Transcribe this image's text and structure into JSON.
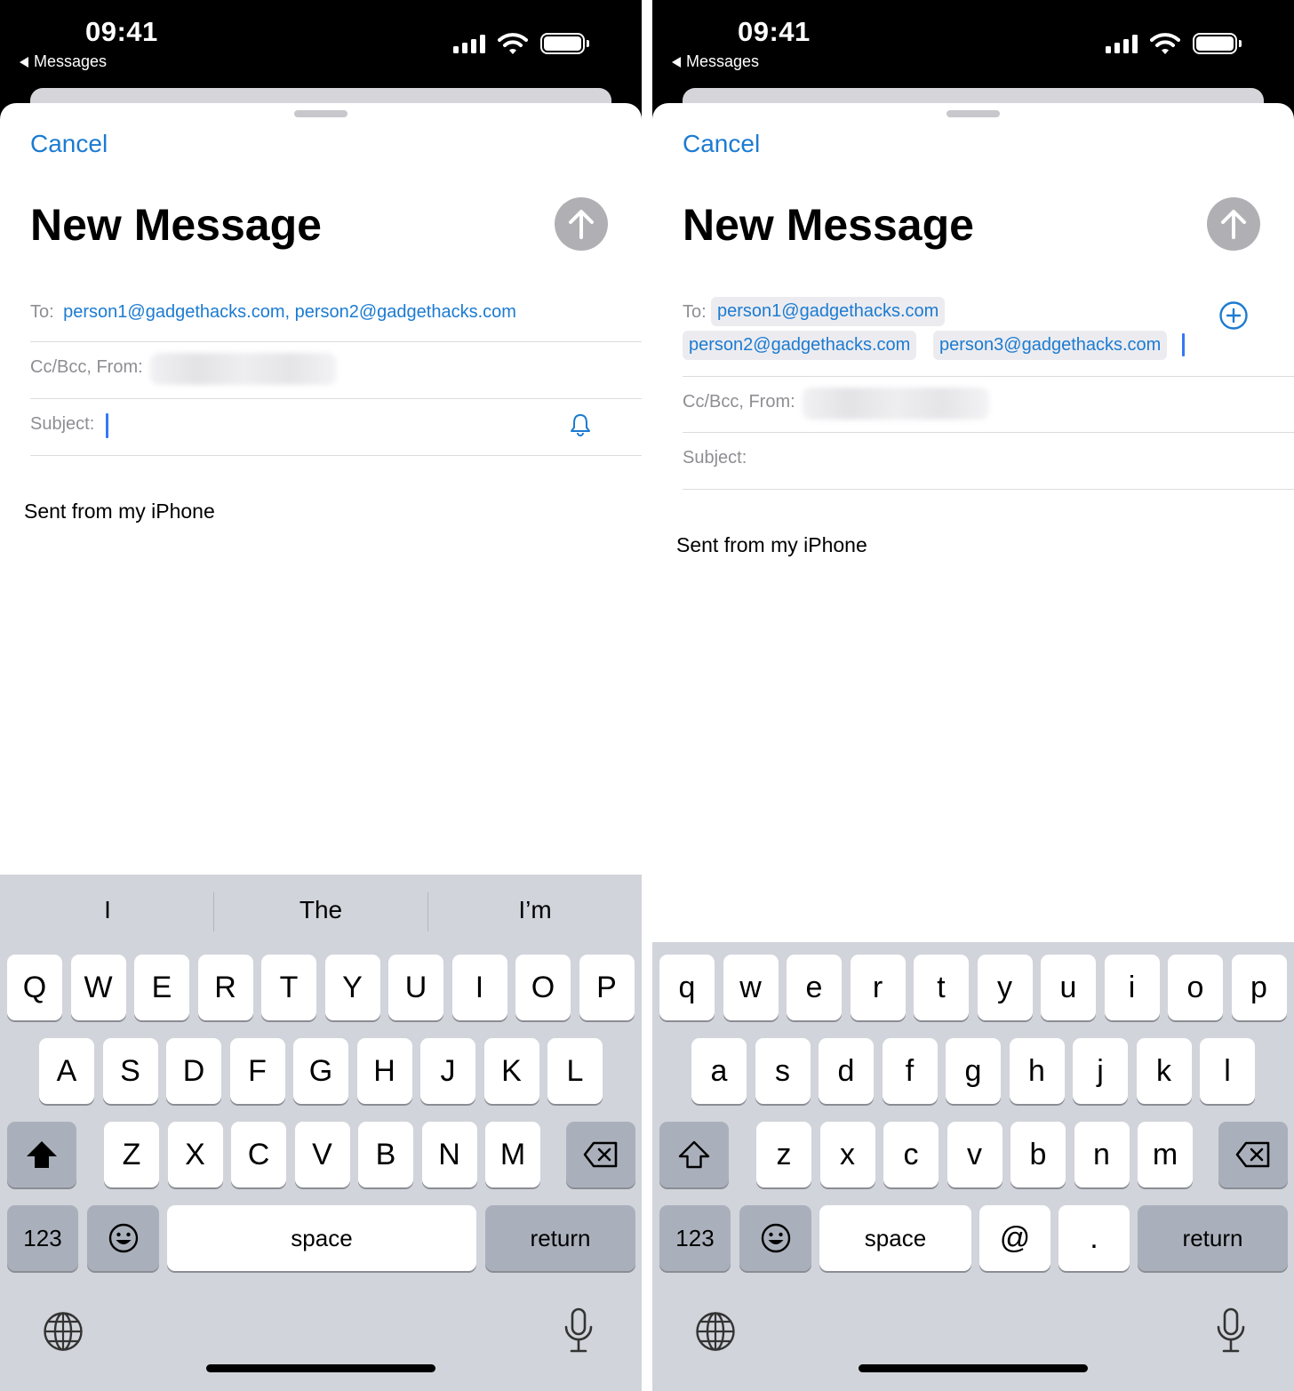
{
  "status": {
    "time": "09:41",
    "back_label": "Messages"
  },
  "colors": {
    "accent": "#1c7bd1",
    "send_disabled": "#b0b0b4",
    "keyboard_bg": "#d1d4da"
  },
  "left": {
    "cancel": "Cancel",
    "title": "New Message",
    "to_label": "To:",
    "to_value": "person1@gadgethacks.com, person2@gadgethacks.com",
    "ccbcc_label": "Cc/Bcc, From:",
    "subject_label": "Subject:",
    "signature": "Sent from my iPhone",
    "predictions": [
      "I",
      "The",
      "I’m"
    ],
    "rows": [
      [
        "Q",
        "W",
        "E",
        "R",
        "T",
        "Y",
        "U",
        "I",
        "O",
        "P"
      ],
      [
        "A",
        "S",
        "D",
        "F",
        "G",
        "H",
        "J",
        "K",
        "L"
      ],
      [
        "Z",
        "X",
        "C",
        "V",
        "B",
        "N",
        "M"
      ]
    ],
    "key_123": "123",
    "key_space": "space",
    "key_return": "return"
  },
  "right": {
    "cancel": "Cancel",
    "title": "New Message",
    "to_label": "To:",
    "recipients": [
      "person1@gadgethacks.com",
      "person2@gadgethacks.com",
      "person3@gadgethacks.com"
    ],
    "ccbcc_label": "Cc/Bcc, From:",
    "subject_label": "Subject:",
    "signature": "Sent from my iPhone",
    "rows": [
      [
        "q",
        "w",
        "e",
        "r",
        "t",
        "y",
        "u",
        "i",
        "o",
        "p"
      ],
      [
        "a",
        "s",
        "d",
        "f",
        "g",
        "h",
        "j",
        "k",
        "l"
      ],
      [
        "z",
        "x",
        "c",
        "v",
        "b",
        "n",
        "m"
      ]
    ],
    "key_123": "123",
    "key_space": "space",
    "key_at": "@",
    "key_dot": ".",
    "key_return": "return"
  },
  "icons": {
    "send": "arrow-up-icon",
    "bell": "bell-icon",
    "add": "plus-circle-icon",
    "shift": "shift-icon",
    "delete": "delete-icon",
    "emoji": "emoji-icon",
    "globe": "globe-icon",
    "mic": "microphone-icon"
  }
}
